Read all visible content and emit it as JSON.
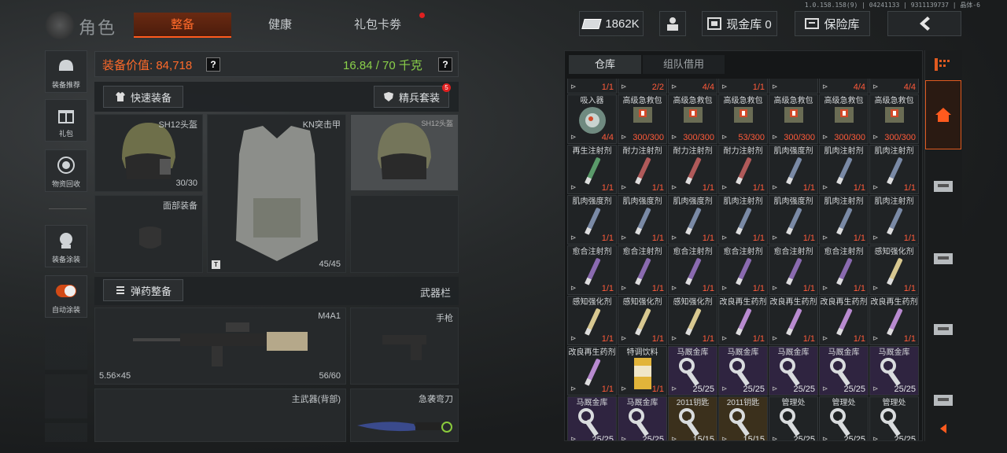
{
  "version": "1.0.158.158(9) | 04241133 | 9311139737 | 晶体-6",
  "header": {
    "title": "角色",
    "tabs": [
      {
        "label": "整备",
        "active": true
      },
      {
        "label": "健康",
        "active": false
      },
      {
        "label": "礼包卡劵",
        "active": false
      }
    ],
    "money": "1862K",
    "cash_vault": "现金库 0",
    "safe_box": "保险库"
  },
  "sidebar": [
    {
      "label": "装备推荐",
      "icon": "helmet-icon"
    },
    {
      "label": "礼包",
      "icon": "gift-icon"
    },
    {
      "label": "物资回收",
      "icon": "recycle-icon"
    },
    {
      "label": "装备涂装",
      "icon": "paint-icon"
    },
    {
      "label": "自动涂装",
      "icon": "toggle-icon"
    }
  ],
  "equipment": {
    "value_label": "装备价值:",
    "value": "84,718",
    "weight": "16.84 / 70 千克",
    "help": "?",
    "quick_equip": "快速装备",
    "elite_set": "精兵套装",
    "elite_badge": "5",
    "helmet": {
      "name": "SH12头盔",
      "count": "30/30"
    },
    "armor": {
      "name": "KN突击甲",
      "count": "45/45",
      "mark": "T"
    },
    "helmet2": {
      "name": "SH12头盔"
    },
    "face": {
      "name": "面部装备"
    },
    "ammo_btn": "弹药整备",
    "weapon_bar": "武器栏",
    "rifle": {
      "name": "M4A1",
      "ammo": "5.56×45",
      "count": "56/60"
    },
    "pistol": {
      "name": "手枪"
    },
    "back": {
      "name": "主武器(背部)"
    },
    "knife": {
      "name": "急袭弯刀"
    }
  },
  "vault": {
    "tabs": [
      "仓库",
      "组队借用"
    ],
    "rows": [
      [
        {
          "name": "",
          "count": "1/1",
          "style": "red"
        },
        {
          "name": "",
          "count": "2/2",
          "style": "red"
        },
        {
          "name": "",
          "count": "4/4",
          "style": "red"
        },
        {
          "name": "",
          "count": "1/1",
          "style": "red"
        },
        {
          "name": "",
          "count": "",
          "style": "red"
        },
        {
          "name": "",
          "count": "4/4",
          "style": "red"
        },
        {
          "name": "",
          "count": "4/4",
          "style": "red"
        }
      ],
      [
        {
          "name": "吸入器",
          "count": "4/4",
          "style": "red"
        },
        {
          "name": "高级急救包",
          "count": "300/300",
          "style": "red"
        },
        {
          "name": "高级急救包",
          "count": "300/300",
          "style": "red"
        },
        {
          "name": "高级急救包",
          "count": "53/300",
          "style": "red"
        },
        {
          "name": "高级急救包",
          "count": "300/300",
          "style": "red"
        },
        {
          "name": "高级急救包",
          "count": "300/300",
          "style": "red"
        },
        {
          "name": "高级急救包",
          "count": "300/300",
          "style": "red"
        }
      ],
      [
        {
          "name": "再生注射剂",
          "count": "1/1",
          "style": "red"
        },
        {
          "name": "耐力注射剂",
          "count": "1/1",
          "style": "red"
        },
        {
          "name": "耐力注射剂",
          "count": "1/1",
          "style": "red"
        },
        {
          "name": "耐力注射剂",
          "count": "1/1",
          "style": "red"
        },
        {
          "name": "肌肉强度剂",
          "count": "1/1",
          "style": "red"
        },
        {
          "name": "肌肉注射剂",
          "count": "1/1",
          "style": "red"
        },
        {
          "name": "肌肉注射剂",
          "count": "1/1",
          "style": "red"
        }
      ],
      [
        {
          "name": "肌肉强度剂",
          "count": "1/1",
          "style": "red"
        },
        {
          "name": "肌肉强度剂",
          "count": "1/1",
          "style": "red"
        },
        {
          "name": "肌肉强度剂",
          "count": "1/1",
          "style": "red"
        },
        {
          "name": "肌肉注射剂",
          "count": "1/1",
          "style": "red"
        },
        {
          "name": "肌肉强度剂",
          "count": "1/1",
          "style": "red"
        },
        {
          "name": "肌肉注射剂",
          "count": "1/1",
          "style": "red"
        },
        {
          "name": "肌肉注射剂",
          "count": "1/1",
          "style": "red"
        }
      ],
      [
        {
          "name": "愈合注射剂",
          "count": "1/1",
          "style": "red"
        },
        {
          "name": "愈合注射剂",
          "count": "1/1",
          "style": "red"
        },
        {
          "name": "愈合注射剂",
          "count": "1/1",
          "style": "red"
        },
        {
          "name": "愈合注射剂",
          "count": "1/1",
          "style": "red"
        },
        {
          "name": "愈合注射剂",
          "count": "1/1",
          "style": "red"
        },
        {
          "name": "愈合注射剂",
          "count": "1/1",
          "style": "red"
        },
        {
          "name": "感知强化剂",
          "count": "1/1",
          "style": "red"
        }
      ],
      [
        {
          "name": "感知强化剂",
          "count": "1/1",
          "style": "red"
        },
        {
          "name": "感知强化剂",
          "count": "1/1",
          "style": "red"
        },
        {
          "name": "感知强化剂",
          "count": "1/1",
          "style": "red"
        },
        {
          "name": "改良再生药剂",
          "count": "1/1",
          "style": "red"
        },
        {
          "name": "改良再生药剂",
          "count": "1/1",
          "style": "red"
        },
        {
          "name": "改良再生药剂",
          "count": "1/1",
          "style": "red"
        },
        {
          "name": "改良再生药剂",
          "count": "1/1",
          "style": "red"
        }
      ],
      [
        {
          "name": "改良再生药剂",
          "count": "1/1",
          "style": "red"
        },
        {
          "name": "特调饮料",
          "count": "1/1",
          "style": "red"
        },
        {
          "name": "马厩金库",
          "count": "25/25",
          "style": "purple"
        },
        {
          "name": "马厩金库",
          "count": "25/25",
          "style": "purple"
        },
        {
          "name": "马厩金库",
          "count": "25/25",
          "style": "purple"
        },
        {
          "name": "马厩金库",
          "count": "25/25",
          "style": "purple"
        },
        {
          "name": "马厩金库",
          "count": "25/25",
          "style": "purple"
        }
      ],
      [
        {
          "name": "马厩金库",
          "count": "25/25",
          "style": "purple"
        },
        {
          "name": "马厩金库",
          "count": "25/25",
          "style": "purple"
        },
        {
          "name": "2011钥匙",
          "count": "15/15",
          "style": "gold"
        },
        {
          "name": "2011钥匙",
          "count": "15/15",
          "style": "gold"
        },
        {
          "name": "管理处",
          "count": "25/25",
          "style": "plain"
        },
        {
          "name": "管理处",
          "count": "25/25",
          "style": "plain"
        },
        {
          "name": "管理处",
          "count": "25/25",
          "style": "plain"
        }
      ]
    ]
  },
  "colors": {
    "accent": "#ff5a1e",
    "value": "#ff6a2a",
    "weight": "#8ad04a",
    "count_red": "#ff5a3a"
  }
}
